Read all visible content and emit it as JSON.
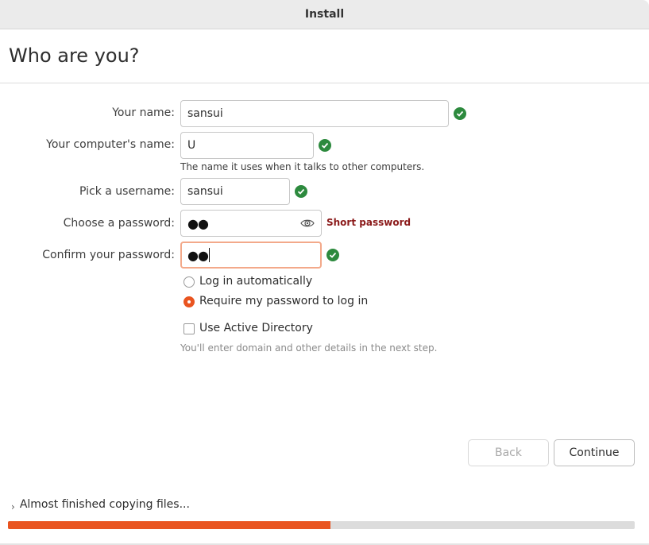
{
  "window": {
    "title": "Install"
  },
  "page": {
    "heading": "Who are you?"
  },
  "form": {
    "name": {
      "label": "Your name:",
      "value": "sansui",
      "status": "valid"
    },
    "computer_name": {
      "label": "Your computer's name:",
      "value": "U",
      "hint": "The name it uses when it talks to other computers.",
      "status": "valid"
    },
    "username": {
      "label": "Pick a username:",
      "value": "sansui",
      "status": "valid"
    },
    "password": {
      "label": "Choose a password:",
      "value": "●●",
      "strength": "Short password",
      "reveal_icon": "eye-icon"
    },
    "confirm": {
      "label": "Confirm your password:",
      "value": "●●",
      "status": "valid"
    },
    "login_options": [
      {
        "label": "Log in automatically",
        "selected": false
      },
      {
        "label": "Require my password to log in",
        "selected": true
      }
    ],
    "active_directory": {
      "label": "Use Active Directory",
      "checked": false,
      "hint": "You'll enter domain and other details in the next step."
    }
  },
  "buttons": {
    "back": "Back",
    "continue": "Continue"
  },
  "status": {
    "text": "Almost finished copying files...",
    "progress": 0.515
  },
  "colors": {
    "accent": "#e95420",
    "valid": "#2d8a3e",
    "warning": "#8b1a1a"
  }
}
